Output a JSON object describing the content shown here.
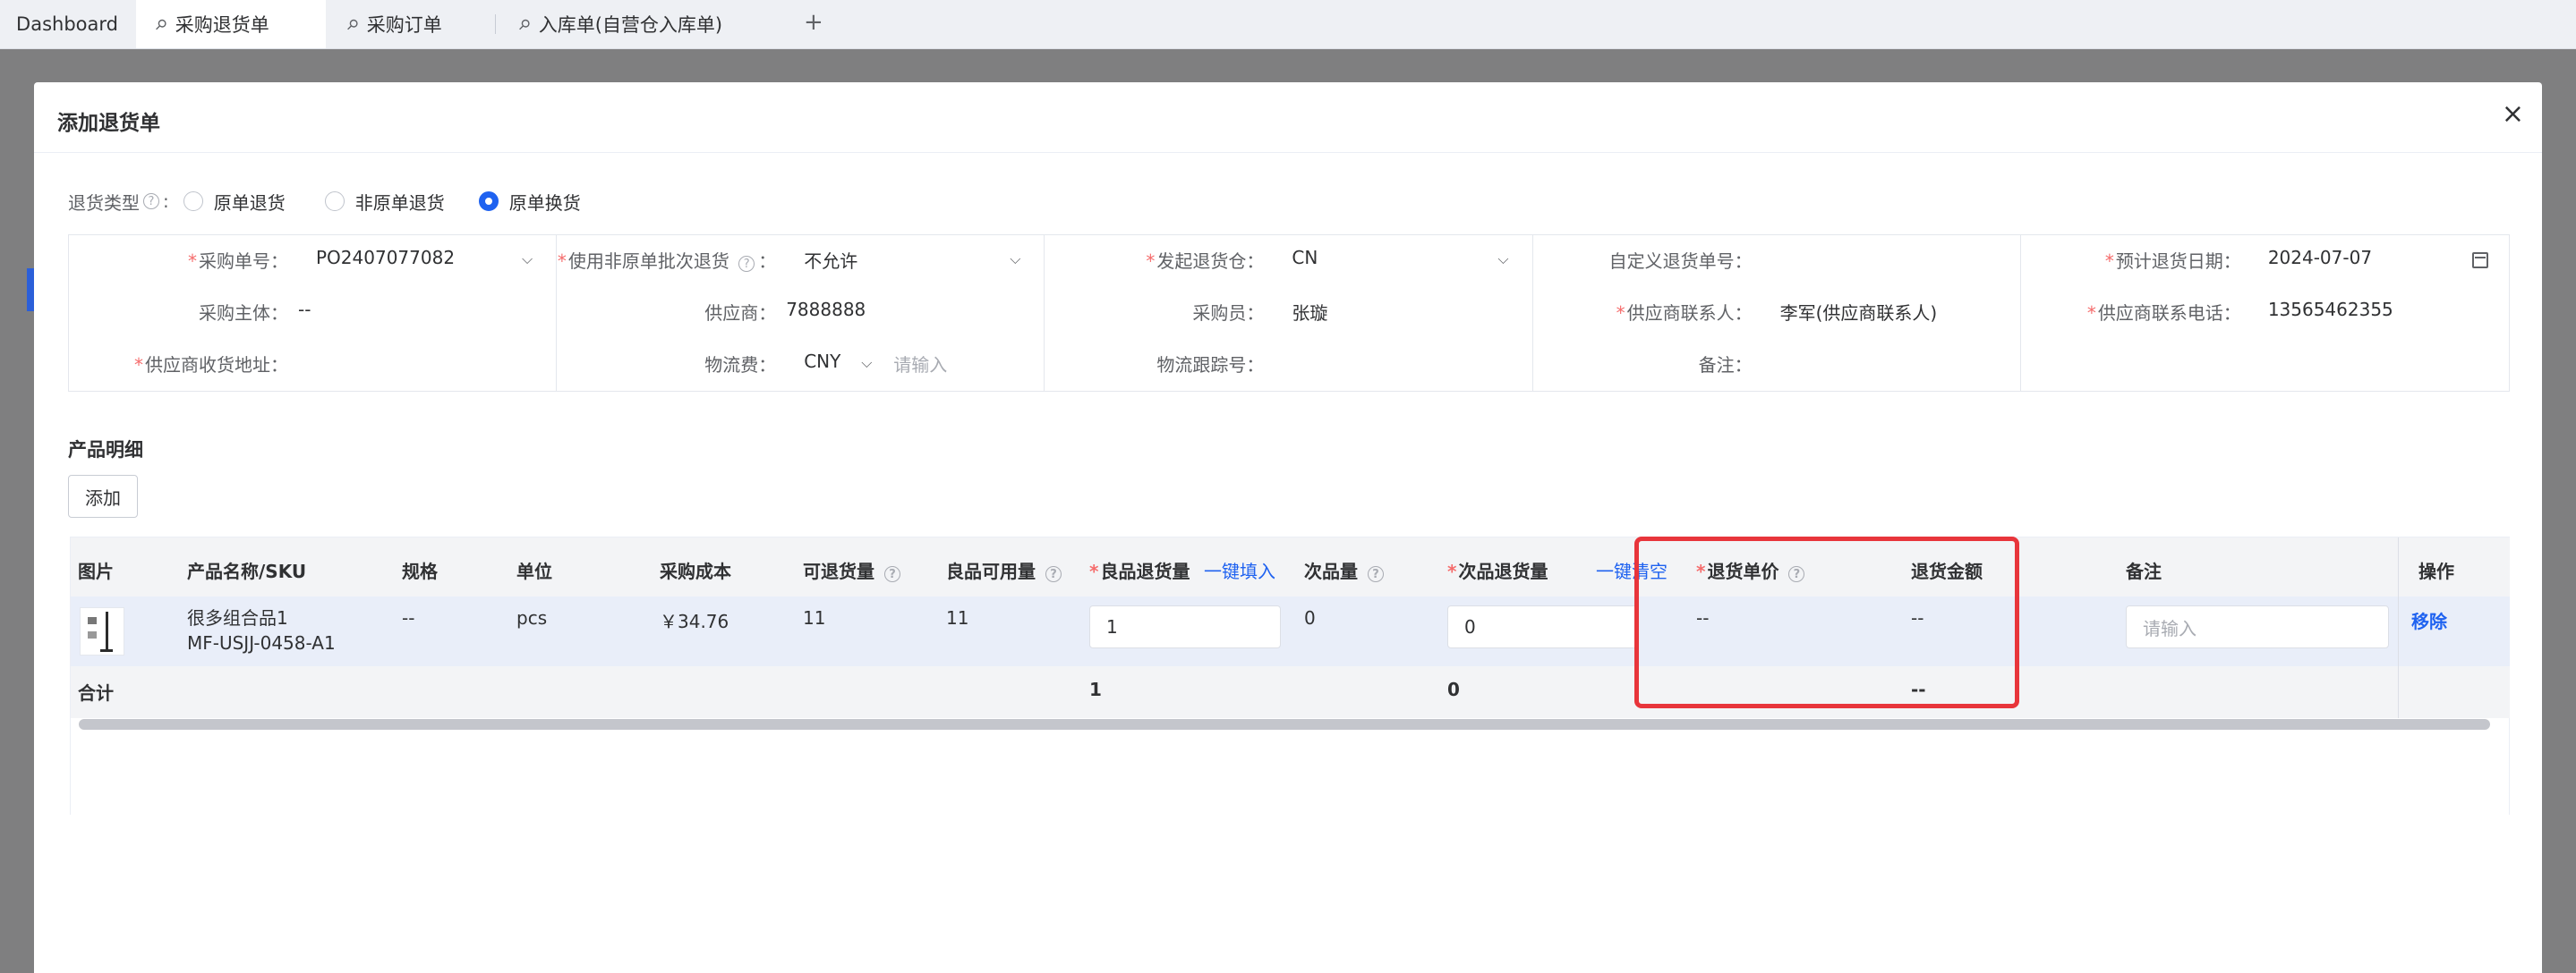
{
  "tabs": [
    {
      "label": "Dashboard"
    },
    {
      "label": "采购退货单"
    },
    {
      "label": "采购订单"
    },
    {
      "label": "入库单(自营仓入库单)"
    }
  ],
  "add_tab_glyph": "+",
  "modal": {
    "title": "添加退货单",
    "close_glyph": "×"
  },
  "return_type": {
    "label": "退货类型",
    "colon": ":",
    "options": [
      "原单退货",
      "非原单退货",
      "原单换货"
    ],
    "selected": "原单换货"
  },
  "form": {
    "po_no": {
      "label": "采购单号：",
      "value": "PO2407077082"
    },
    "purchase_subject": {
      "label": "采购主体：",
      "value": "--"
    },
    "supplier_address": {
      "label": "供应商收货地址："
    },
    "use_non_original_batch": {
      "label": "使用非原单批次退货",
      "value": "不允许"
    },
    "supplier": {
      "label": "供应商：",
      "value": "7888888"
    },
    "logistics_fee": {
      "label": "物流费：",
      "currency": "CNY",
      "placeholder": "请输入"
    },
    "warehouse": {
      "label": "发起退货仓：",
      "value": "CN"
    },
    "buyer": {
      "label": "采购员：",
      "value": "张璇"
    },
    "tracking_no": {
      "label": "物流跟踪号："
    },
    "custom_return_no": {
      "label": "自定义退货单号："
    },
    "supplier_contact": {
      "label": "供应商联系人：",
      "value": "李军(供应商联系人)"
    },
    "remark": {
      "label": "备注："
    },
    "expected_date": {
      "label": "预计退货日期：",
      "value": "2024-07-07"
    },
    "supplier_phone": {
      "label": "供应商联系电话：",
      "value": "13565462355"
    }
  },
  "product_section": {
    "title": "产品明细",
    "add_button": "添加"
  },
  "table": {
    "headers": {
      "image": "图片",
      "name_sku": "产品名称/SKU",
      "spec": "规格",
      "unit": "单位",
      "cost": "采购成本",
      "returnable_qty": "可退货量",
      "good_available": "良品可用量",
      "good_return_qty": "良品退货量",
      "fill_all": "一键填入",
      "defect_qty": "次品量",
      "defect_return_qty": "次品退货量",
      "clear_all": "一键清空",
      "return_price": "退货单价",
      "return_amount": "退货金额",
      "remark": "备注",
      "action": "操作"
    },
    "row": {
      "name": "很多组合品1",
      "sku": "MF-USJJ-0458-A1",
      "spec": "--",
      "unit": "pcs",
      "cost": "￥34.76",
      "returnable_qty": "11",
      "good_available": "11",
      "good_return_qty": "1",
      "defect_qty": "0",
      "defect_return_qty": "0",
      "return_price": "--",
      "return_amount": "--",
      "remark_placeholder": "请输入",
      "action_label": "移除"
    },
    "summary": {
      "label": "合计",
      "good_return_total": "1",
      "defect_return_total": "0",
      "amount_total": "--"
    }
  },
  "colors": {
    "accent": "#1f62f0",
    "required": "#f56c6c",
    "highlight": "#e8353b"
  }
}
